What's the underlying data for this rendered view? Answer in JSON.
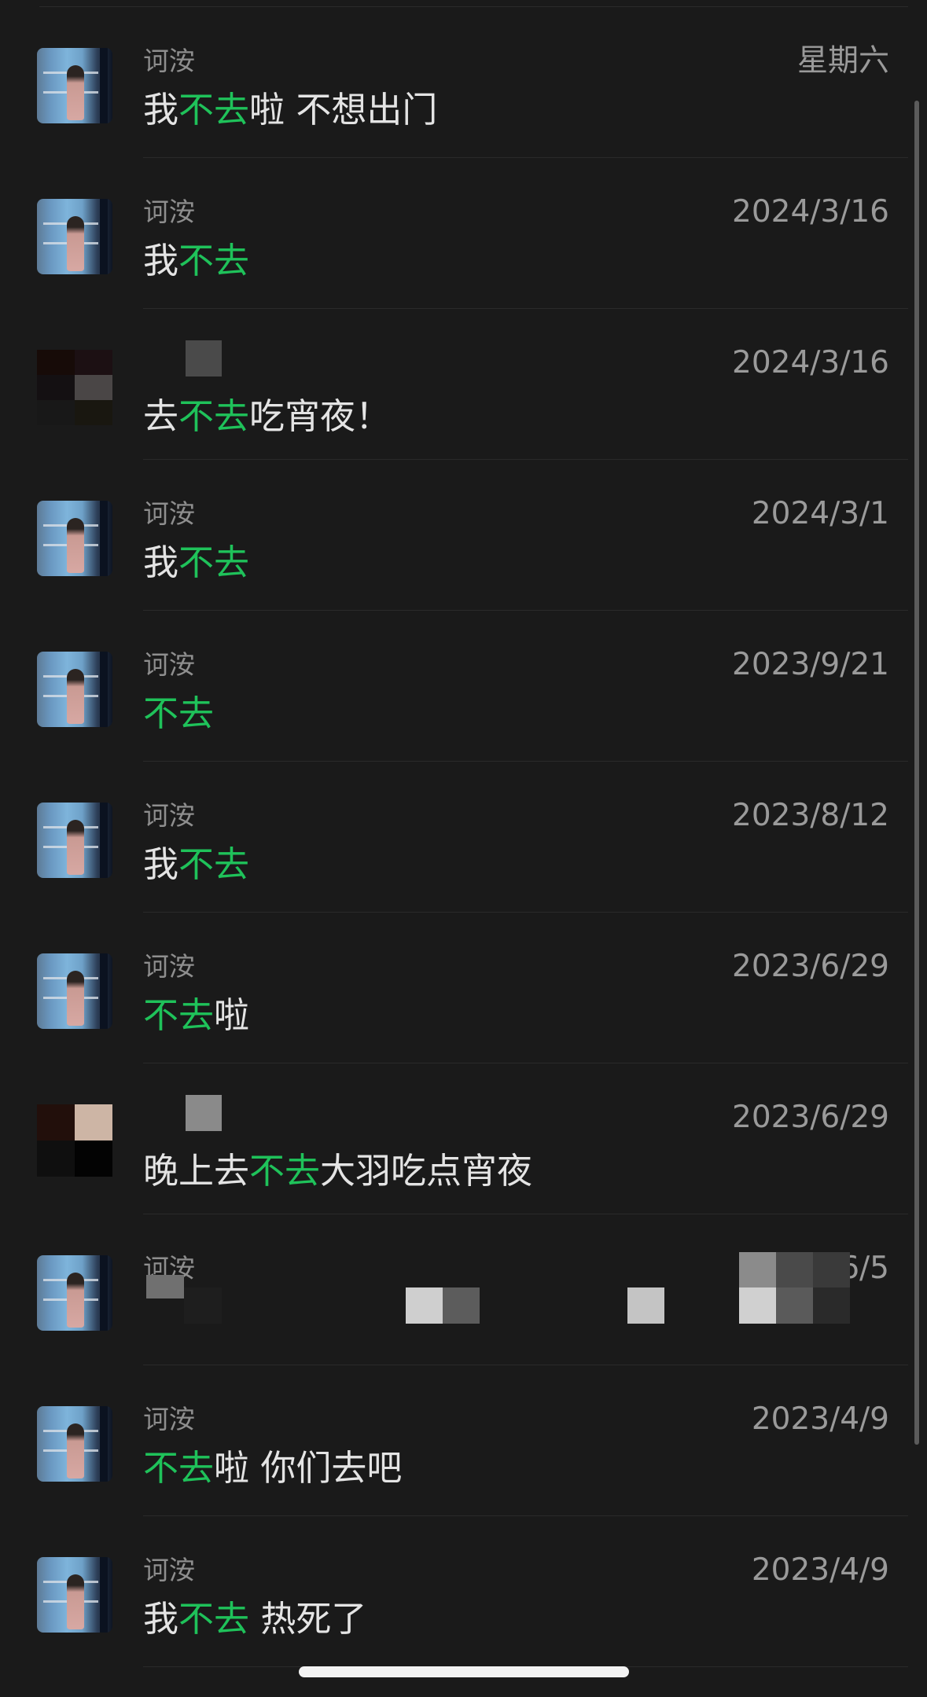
{
  "conversations": [
    {
      "avatar": "photo",
      "name": "诃洝",
      "time": "星期六",
      "preview": [
        {
          "text": "我",
          "highlight": false
        },
        {
          "text": "不去",
          "highlight": true
        },
        {
          "text": "啦 不想出门",
          "highlight": false
        }
      ]
    },
    {
      "avatar": "photo",
      "name": "诃洝",
      "time": "2024/3/16",
      "preview": [
        {
          "text": "我",
          "highlight": false
        },
        {
          "text": "不去",
          "highlight": true
        }
      ]
    },
    {
      "avatar": "mosaic",
      "name": "",
      "time": "2024/3/16",
      "preview": [
        {
          "text": "去",
          "highlight": false
        },
        {
          "text": "不去",
          "highlight": true
        },
        {
          "text": "吃宵夜！",
          "highlight": false
        }
      ]
    },
    {
      "avatar": "photo",
      "name": "诃洝",
      "time": "2024/3/1",
      "preview": [
        {
          "text": "我",
          "highlight": false
        },
        {
          "text": "不去",
          "highlight": true
        }
      ]
    },
    {
      "avatar": "photo",
      "name": "诃洝",
      "time": "2023/9/21",
      "preview": [
        {
          "text": "不去",
          "highlight": true
        }
      ]
    },
    {
      "avatar": "photo",
      "name": "诃洝",
      "time": "2023/8/12",
      "preview": [
        {
          "text": "我",
          "highlight": false
        },
        {
          "text": "不去",
          "highlight": true
        }
      ]
    },
    {
      "avatar": "photo",
      "name": "诃洝",
      "time": "2023/6/29",
      "preview": [
        {
          "text": "不去",
          "highlight": true
        },
        {
          "text": "啦",
          "highlight": false
        }
      ]
    },
    {
      "avatar": "mosaic",
      "name": "",
      "time": "2023/6/29",
      "preview": [
        {
          "text": "晚上去",
          "highlight": false
        },
        {
          "text": "不去",
          "highlight": true
        },
        {
          "text": "大羽吃点宵夜",
          "highlight": false
        }
      ]
    },
    {
      "avatar": "photo",
      "name": "诃洝",
      "time": "6/5",
      "preview": [
        {
          "text": "",
          "highlight": false
        }
      ]
    },
    {
      "avatar": "photo",
      "name": "诃洝",
      "time": "2023/4/9",
      "preview": [
        {
          "text": "不去",
          "highlight": true
        },
        {
          "text": "啦 你们去吧",
          "highlight": false
        }
      ]
    },
    {
      "avatar": "photo",
      "name": "诃洝",
      "time": "2023/4/9",
      "preview": [
        {
          "text": "我",
          "highlight": false
        },
        {
          "text": "不去",
          "highlight": true
        },
        {
          "text": " 热死了",
          "highlight": false
        }
      ]
    }
  ],
  "colors": {
    "background": "#1a1a1a",
    "highlight": "#1fc25a",
    "primary_text": "#e4e4e4",
    "secondary_text": "#8e8e8e",
    "divider": "#2a2a2a"
  }
}
